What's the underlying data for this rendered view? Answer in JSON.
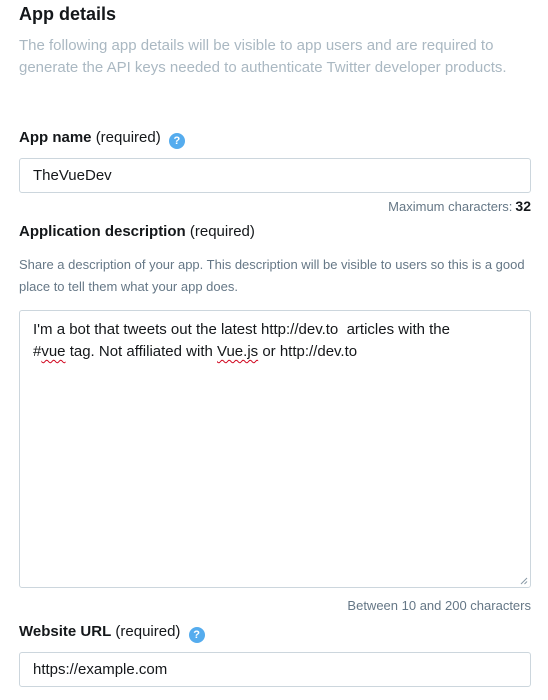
{
  "section": {
    "title": "App details",
    "intro": "The following app details will be visible to app users and are required to generate the API keys needed to authenticate Twitter developer products."
  },
  "app_name": {
    "label": "App name",
    "required": "(required)",
    "help_glyph": "?",
    "value": "TheVueDev",
    "counter_label": "Maximum characters:",
    "counter_value": "32"
  },
  "app_description": {
    "label": "Application description",
    "required": "(required)",
    "help": "Share a description of your app. This description will be visible to users so this is a good place to tell them what your app does.",
    "value_line1": "I'm a bot that tweets out the latest http://dev.to  articles with the",
    "value_line2_part1": "#",
    "value_line2_misspelled1": "vue",
    "value_line2_part2": " tag. Not affiliated with ",
    "value_line2_misspelled2": "Vue.js",
    "value_line2_part3": " or http://dev.to",
    "counter": "Between 10 and 200 characters"
  },
  "website_url": {
    "label": "Website URL",
    "required": "(required)",
    "help_glyph": "?",
    "value": "https://example.com"
  },
  "colors": {
    "help_icon": "#55acee",
    "muted_text": "#aab8c2",
    "secondary_text": "#657786",
    "input_border": "#ccd6dd",
    "spellcheck_underline": "#d0021b"
  },
  "icons": {
    "help": "question-circle-icon",
    "resize": "resize-grip-icon"
  }
}
